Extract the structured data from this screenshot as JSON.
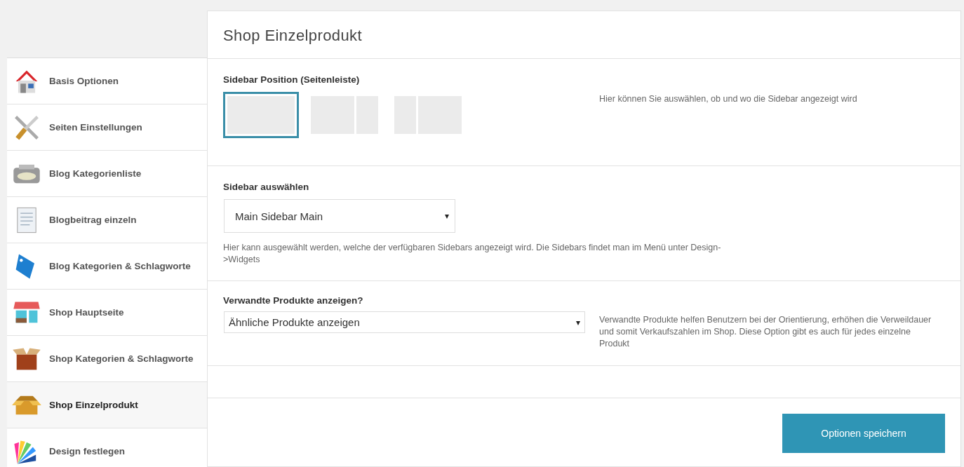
{
  "nav": [
    {
      "label": "Basis Optionen",
      "selected": false
    },
    {
      "label": "Seiten Einstellungen",
      "selected": false
    },
    {
      "label": "Blog Kategorienliste",
      "selected": false
    },
    {
      "label": "Blogbeitrag einzeln",
      "selected": false
    },
    {
      "label": "Blog Kategorien & Schlagworte",
      "selected": false
    },
    {
      "label": "Shop Hauptseite",
      "selected": false
    },
    {
      "label": "Shop Kategorien & Schlagworte",
      "selected": false
    },
    {
      "label": "Shop Einzelprodukt",
      "selected": true
    },
    {
      "label": "Design festlegen",
      "selected": false
    }
  ],
  "panel": {
    "title": "Shop Einzelprodukt",
    "sidebar_position": {
      "label": "Sidebar Position (Seitenleiste)",
      "options": [
        {
          "kind": "full",
          "selected": true
        },
        {
          "kind": "right",
          "selected": false
        },
        {
          "kind": "left",
          "selected": false
        }
      ],
      "description": "Hier können Sie auswählen, ob und wo die Sidebar angezeigt wird"
    },
    "sidebar_select": {
      "label": "Sidebar auswählen",
      "value": "Main Sidebar Main",
      "caret": "▾",
      "description": "Hier kann ausgewählt werden, welche der verfügbaren Sidebars angezeigt wird. Die Sidebars findet man im Menü unter Design->Widgets"
    },
    "related_products": {
      "label": "Verwandte Produkte anzeigen?",
      "value": "Ähnliche Produkte anzeigen",
      "caret": "▾",
      "description": "Verwandte Produkte helfen Benutzern bei der Orientierung, erhöhen die Verweildauer und somit Verkaufszahlen im Shop. Diese Option gibt es auch für jedes einzelne Produkt"
    },
    "save_button": "Optionen speichern"
  }
}
